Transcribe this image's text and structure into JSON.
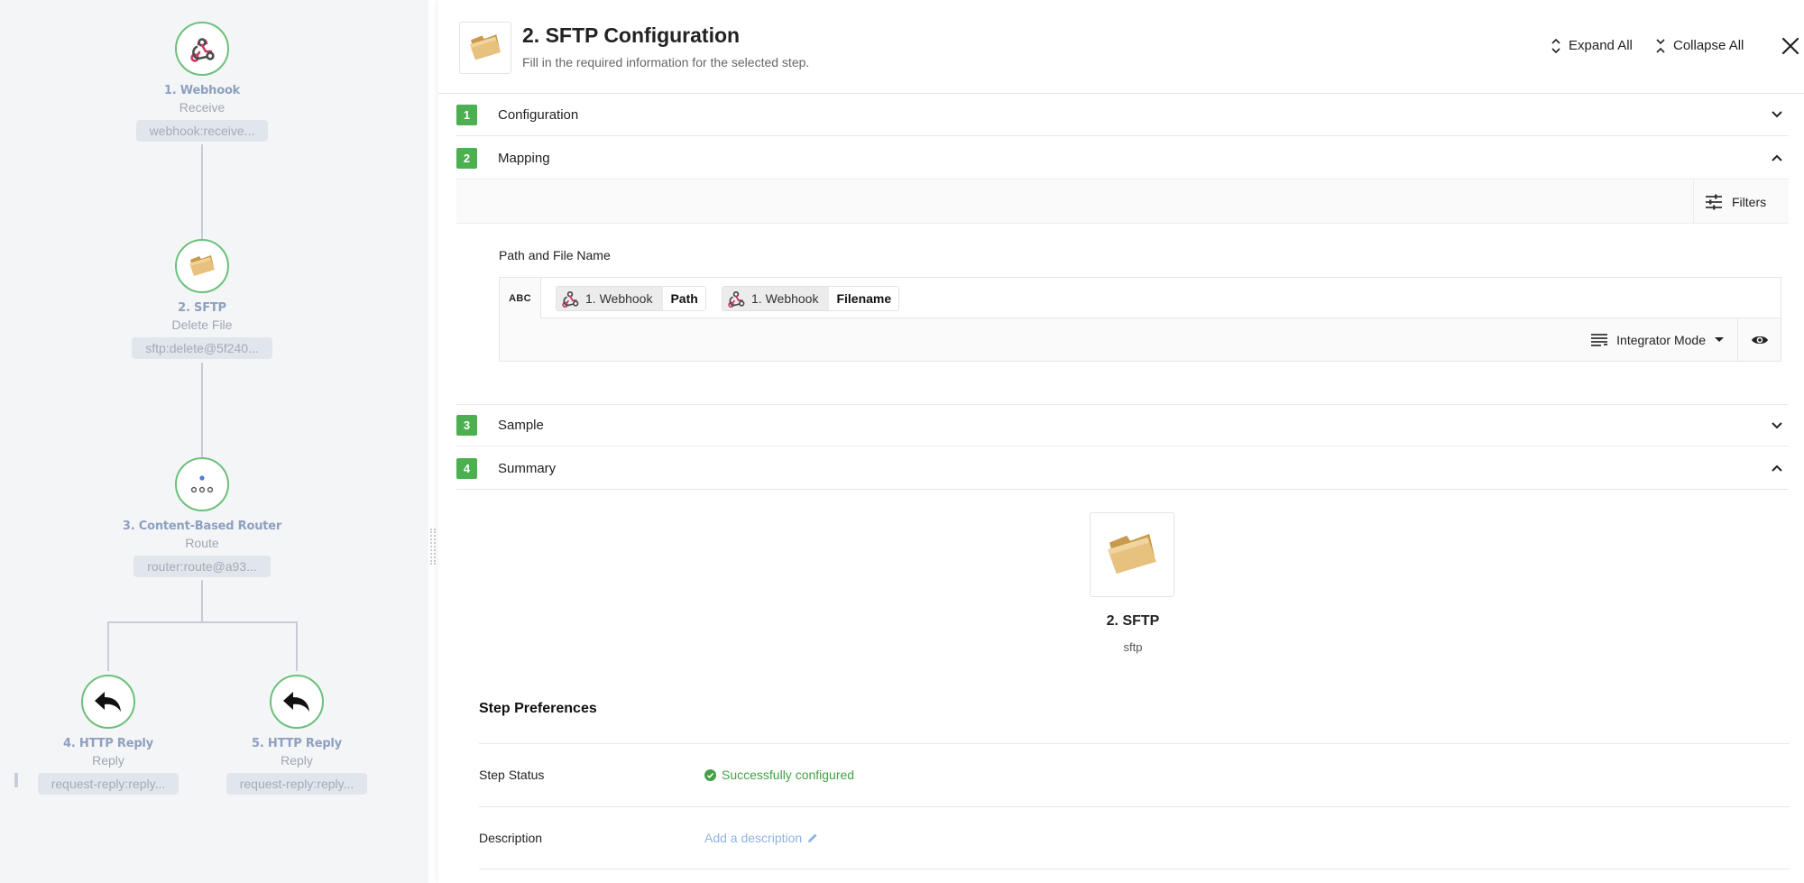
{
  "flow": {
    "nodes": [
      {
        "title": "1. Webhook",
        "subtitle": "Receive",
        "chip": "webhook:receive..."
      },
      {
        "title": "2. SFTP",
        "subtitle": "Delete File",
        "chip": "sftp:delete@5f240..."
      },
      {
        "title": "3. Content-Based Router",
        "subtitle": "Route",
        "chip": "router:route@a93..."
      },
      {
        "title": "4. HTTP Reply",
        "subtitle": "Reply",
        "chip": "request-reply:reply..."
      },
      {
        "title": "5. HTTP Reply",
        "subtitle": "Reply",
        "chip": "request-reply:reply..."
      }
    ]
  },
  "header": {
    "title": "2. SFTP Configuration",
    "subtitle": "Fill in the required information for the selected step.",
    "expand_all": "Expand All",
    "collapse_all": "Collapse All"
  },
  "sections": [
    {
      "number": "1",
      "label": "Configuration",
      "state": "collapsed"
    },
    {
      "number": "2",
      "label": "Mapping",
      "state": "expanded"
    },
    {
      "number": "3",
      "label": "Sample",
      "state": "collapsed"
    },
    {
      "number": "4",
      "label": "Summary",
      "state": "expanded"
    }
  ],
  "mapping": {
    "filters_label": "Filters",
    "field_label": "Path and File Name",
    "type_label": "ABC",
    "tokens": [
      {
        "source": "1. Webhook",
        "field": "Path"
      },
      {
        "source": "1. Webhook",
        "field": "Filename"
      }
    ],
    "mode_label": "Integrator Mode"
  },
  "summary": {
    "title": "2. SFTP",
    "subtitle": "sftp"
  },
  "preferences": {
    "title": "Step Preferences",
    "status_label": "Step Status",
    "status_value": "Successfully configured",
    "description_label": "Description",
    "description_value": "Add a description"
  },
  "colors": {
    "accent_green": "#4caf50",
    "node_border": "#6cc07a",
    "link_blue": "#8fb3e3",
    "success_text": "#43a047"
  }
}
